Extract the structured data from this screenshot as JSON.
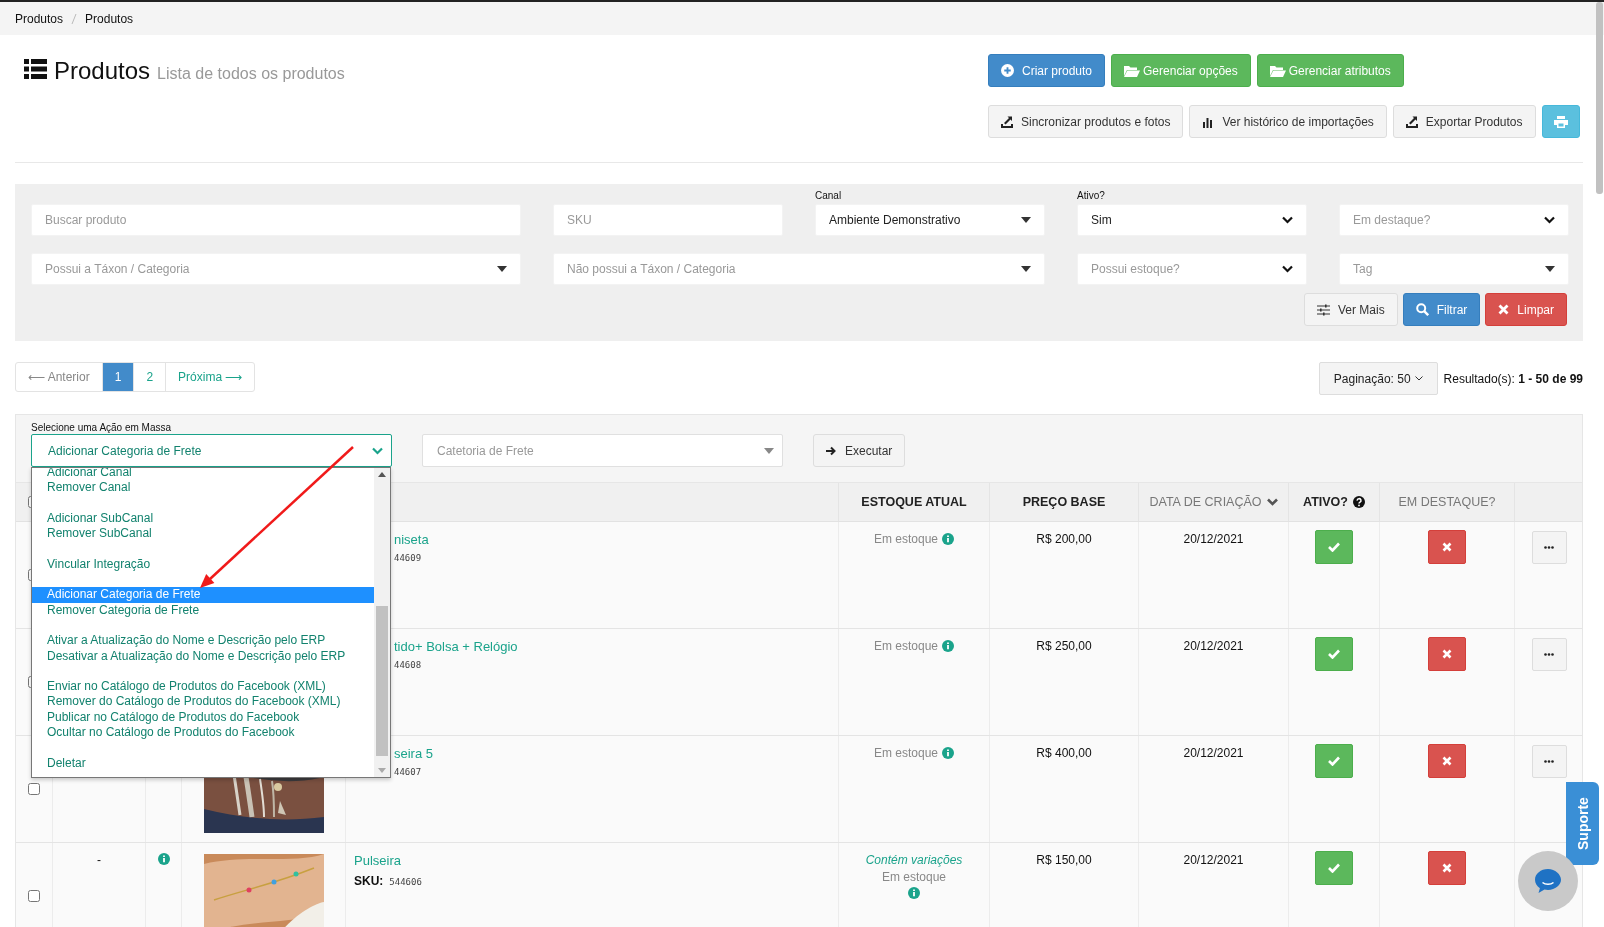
{
  "breadcrumb": [
    {
      "label": "Produtos"
    },
    {
      "label": "Produtos"
    }
  ],
  "header": {
    "title": "Produtos",
    "subtitle": "Lista de todos os produtos"
  },
  "toolbar_rows": [
    {
      "buttons": [
        {
          "kind": "create",
          "label": "Criar produto"
        },
        {
          "kind": "options",
          "label": "Gerenciar opções"
        },
        {
          "kind": "attributes",
          "label": "Gerenciar atributos"
        }
      ]
    },
    {
      "buttons": [
        {
          "kind": "sync",
          "label": "Sincronizar produtos e fotos"
        },
        {
          "kind": "history",
          "label": "Ver histórico de importações"
        },
        {
          "kind": "export",
          "label": "Exportar Produtos"
        },
        {
          "kind": "print"
        }
      ]
    }
  ],
  "filters": {
    "rows": [
      {
        "fields": [
          {
            "kind": "text",
            "placeholder": "Buscar produto"
          },
          {
            "kind": "text",
            "placeholder": "SKU"
          },
          {
            "kind": "select",
            "label": "Canal",
            "value": "Ambiente Demonstrativo"
          },
          {
            "kind": "native",
            "label": "Ativo?",
            "value": "Sim"
          },
          {
            "kind": "native",
            "placeholder": "Em destaque?"
          }
        ]
      },
      {
        "fields": [
          {
            "kind": "select",
            "placeholder": "Possui a Táxon / Categoria"
          },
          {
            "kind": "select",
            "placeholder": "Não possui a Táxon / Categoria"
          },
          {
            "kind": "native",
            "placeholder": "Possui estoque?"
          },
          {
            "kind": "select",
            "placeholder": "Tag"
          }
        ]
      }
    ],
    "buttons": [
      {
        "kind": "more",
        "label": "Ver Mais"
      },
      {
        "kind": "filter",
        "label": "Filtrar"
      },
      {
        "kind": "clear",
        "label": "Limpar"
      }
    ]
  },
  "pagination": {
    "prev": {
      "label": "⟵ Anterior",
      "disabled": true
    },
    "pages": [
      {
        "label": "1",
        "selected": true
      },
      {
        "label": "2",
        "selected": false
      }
    ],
    "next": {
      "label": "Próxima ⟶",
      "disabled": false
    },
    "page_size": "Paginação: 50",
    "results": "Resultado(s): **1 - 50 de 99**"
  },
  "mass_action": {
    "label": "Selecione uma Ação em Massa",
    "value": "Adicionar Categoria de Frete",
    "expanded": true,
    "groups": [
      {
        "options": [
          {
            "label": "Adicionar Canal",
            "selected": false
          },
          {
            "label": "Remover Canal",
            "selected": false
          }
        ]
      },
      {
        "options": [
          {
            "label": "Adicionar SubCanal",
            "selected": false
          },
          {
            "label": "Remover SubCanal",
            "selected": false
          }
        ]
      },
      {
        "options": [
          {
            "label": "Vincular Integração",
            "selected": false
          }
        ]
      },
      {
        "options": [
          {
            "label": "Adicionar Categoria de Frete",
            "selected": true
          },
          {
            "label": "Remover Categoria de Frete",
            "selected": false
          }
        ]
      },
      {
        "options": [
          {
            "label": "Ativar a Atualização do Nome e Descrição pelo ERP",
            "selected": false
          },
          {
            "label": "Desativar a Atualização do Nome e Descrição pelo ERP",
            "selected": false
          }
        ]
      },
      {
        "options": [
          {
            "label": "Enviar no Catálogo de Produtos do Facebook (XML)",
            "selected": false
          },
          {
            "label": "Remover do Catálogo de Produtos do Facebook (XML)",
            "selected": false
          },
          {
            "label": "Publicar no Catálogo de Produtos do Facebook",
            "selected": false
          },
          {
            "label": "Ocultar no Catálogo de Produtos do Facebook",
            "selected": false
          }
        ]
      },
      {
        "options": [
          {
            "label": "Deletar",
            "selected": false
          }
        ]
      }
    ],
    "shipping_placeholder": "Catetoria de Frete",
    "execute": "Executar"
  },
  "table": {
    "all_checked": false,
    "columns": [
      {
        "label": "ESTOQUE ATUAL",
        "sortable": false,
        "sorted": false,
        "help": false
      },
      {
        "label": "PREÇO BASE",
        "sortable": false,
        "sorted": false,
        "help": false
      },
      {
        "label": "DATA DE CRIAÇÃO",
        "sortable": true,
        "sorted": true,
        "help": false
      },
      {
        "label": "ATIVO?",
        "sortable": false,
        "sorted": false,
        "help": true
      },
      {
        "label": "EM DESTAQUE?",
        "sortable": true,
        "sorted": false,
        "help": false
      }
    ],
    "rows": [
      {
        "checked": false,
        "covered": true,
        "name": "niseta",
        "sku": "44609",
        "stock": "Em estoque",
        "price": "R$ 200,00",
        "created": "20/12/2021",
        "active": true,
        "featured": false,
        "more_button": true
      },
      {
        "checked": false,
        "covered": true,
        "name": "tido+ Bolsa + Relógio",
        "sku": "44608",
        "stock": "Em estoque",
        "price": "R$ 250,00",
        "created": "20/12/2021",
        "active": true,
        "featured": false,
        "more_button": true
      },
      {
        "checked": false,
        "covered": true,
        "picture": true,
        "name": "seira 5",
        "sku": "44607",
        "stock": "Em estoque",
        "price": "R$ 400,00",
        "created": "20/12/2021",
        "active": true,
        "featured": false,
        "more_button": true
      },
      {
        "checked": false,
        "covered": false,
        "dash": "-",
        "has_info": true,
        "picture": true,
        "name": "Pulseira",
        "sku_label": "SKU:",
        "sku": "544606",
        "variations": "Contém variações",
        "stock": "Em estoque",
        "price": "R$ 150,00",
        "created": "20/12/2021",
        "active": true,
        "featured": false
      }
    ]
  },
  "support_tab": "Suporte"
}
